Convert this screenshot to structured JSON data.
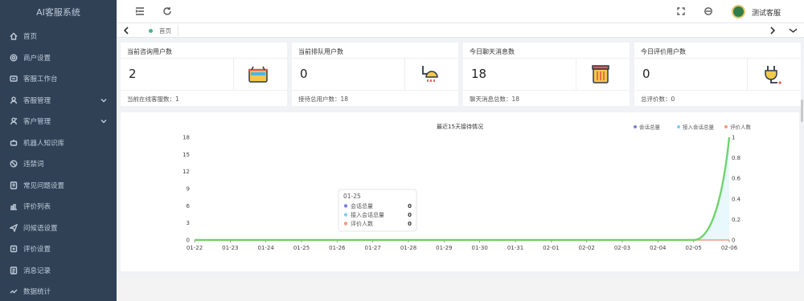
{
  "app": {
    "title": "AI客服系统"
  },
  "sidebar": {
    "items": [
      {
        "label": "首页",
        "icon": "home-icon",
        "expandable": false
      },
      {
        "label": "商户设置",
        "icon": "settings-icon",
        "expandable": false
      },
      {
        "label": "客服工作台",
        "icon": "workbench-icon",
        "expandable": false
      },
      {
        "label": "客服管理",
        "icon": "user-icon",
        "expandable": true
      },
      {
        "label": "客户管理",
        "icon": "customer-icon",
        "expandable": true
      },
      {
        "label": "机器人知识库",
        "icon": "robot-icon",
        "expandable": false
      },
      {
        "label": "违禁词",
        "icon": "forbidden-icon",
        "expandable": false
      },
      {
        "label": "常见问题设置",
        "icon": "faq-icon",
        "expandable": false
      },
      {
        "label": "评价列表",
        "icon": "rating-icon",
        "expandable": false
      },
      {
        "label": "问候语设置",
        "icon": "greeting-icon",
        "expandable": false
      },
      {
        "label": "评价设置",
        "icon": "rating-settings-icon",
        "expandable": false
      },
      {
        "label": "消息记录",
        "icon": "message-log-icon",
        "expandable": false
      },
      {
        "label": "数据统计",
        "icon": "statistics-icon",
        "expandable": false
      }
    ]
  },
  "header": {
    "username": "测试客服"
  },
  "tags": {
    "home_label": "首页"
  },
  "cards": [
    {
      "title": "当前咨询用户数",
      "value": "2",
      "footer": "当前在线客服数：1",
      "icon": "basket-icon"
    },
    {
      "title": "当前排队用户数",
      "value": "0",
      "footer": "接待总用户数：18",
      "icon": "shower-icon"
    },
    {
      "title": "今日聊天消息数",
      "value": "18",
      "footer": "聊天消息总数：18",
      "icon": "cabinet-icon"
    },
    {
      "title": "今日评价用户数",
      "value": "0",
      "footer": "总评价数：0",
      "icon": "plug-icon"
    }
  ],
  "chart_data": {
    "type": "line",
    "title": "最近15天接待情况",
    "categories": [
      "01-22",
      "01-23",
      "01-24",
      "01-25",
      "01-26",
      "01-27",
      "01-28",
      "01-29",
      "01-30",
      "01-31",
      "02-01",
      "02-02",
      "02-03",
      "02-04",
      "02-05",
      "02-06"
    ],
    "series": [
      {
        "name": "会话总量",
        "color": "#7b7fe0",
        "axis": "left",
        "values": [
          0,
          0,
          0,
          0,
          0,
          0,
          0,
          0,
          0,
          0,
          0,
          0,
          0,
          0,
          0,
          18
        ]
      },
      {
        "name": "接入会话总量",
        "color": "#7ecff5",
        "axis": "left",
        "values": [
          0,
          0,
          0,
          0,
          0,
          0,
          0,
          0,
          0,
          0,
          0,
          0,
          0,
          0,
          0,
          18
        ]
      },
      {
        "name": "评价人数",
        "color": "#f19a7f",
        "axis": "right",
        "values": [
          0,
          0,
          0,
          0,
          0,
          0,
          0,
          0,
          0,
          0,
          0,
          0,
          0,
          0,
          0,
          0
        ]
      }
    ],
    "highlight_color": "#6cd35f",
    "ylim_left": [
      0,
      18
    ],
    "yticks_left": [
      0,
      3,
      6,
      9,
      12,
      15,
      18
    ],
    "ylim_right": [
      0,
      1
    ],
    "yticks_right": [
      "0",
      "0.2",
      "0.4",
      "0.6",
      "0.8",
      "1"
    ],
    "legend_position": "top-right",
    "tooltip": {
      "title": "01-25",
      "rows": [
        {
          "name": "会话总量",
          "value": "0"
        },
        {
          "name": "接入会话总量",
          "value": "0"
        },
        {
          "name": "评价人数",
          "value": "0"
        }
      ]
    }
  }
}
